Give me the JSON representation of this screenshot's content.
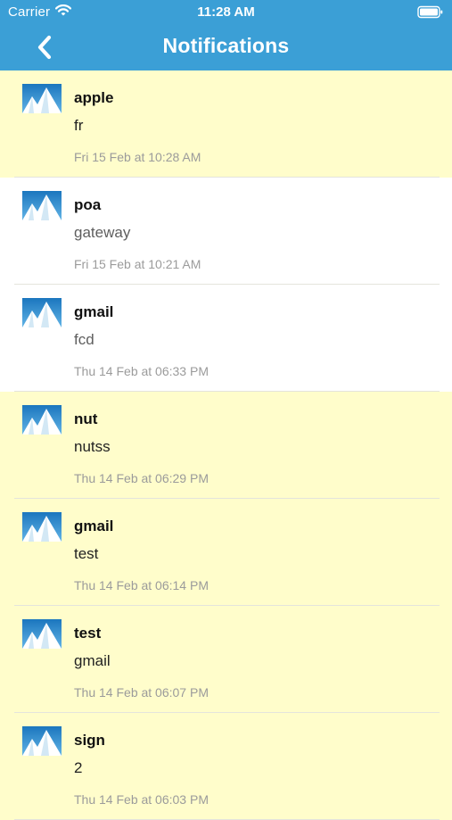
{
  "status_bar": {
    "carrier": "Carrier",
    "time": "11:28 AM"
  },
  "nav": {
    "title": "Notifications",
    "back_icon": "chevron-left-icon",
    "color": "#3b9fd6"
  },
  "colors": {
    "unread_background": "#fffdcb",
    "read_background": "#ffffff"
  },
  "notifications": [
    {
      "title": "apple",
      "message": "fr",
      "time": "Fri 15 Feb at 10:28 AM",
      "unread": true
    },
    {
      "title": "poa",
      "message": "gateway",
      "time": "Fri 15 Feb at 10:21 AM",
      "unread": false
    },
    {
      "title": "gmail",
      "message": "fcd",
      "time": "Thu 14 Feb at 06:33 PM",
      "unread": false
    },
    {
      "title": "nut",
      "message": "nutss",
      "time": "Thu 14 Feb at 06:29 PM",
      "unread": true
    },
    {
      "title": "gmail",
      "message": "test",
      "time": "Thu 14 Feb at 06:14 PM",
      "unread": true
    },
    {
      "title": "test",
      "message": "gmail",
      "time": "Thu 14 Feb at 06:07 PM",
      "unread": true
    },
    {
      "title": "sign",
      "message": "2",
      "time": "Thu 14 Feb at 06:03 PM",
      "unread": true
    }
  ]
}
